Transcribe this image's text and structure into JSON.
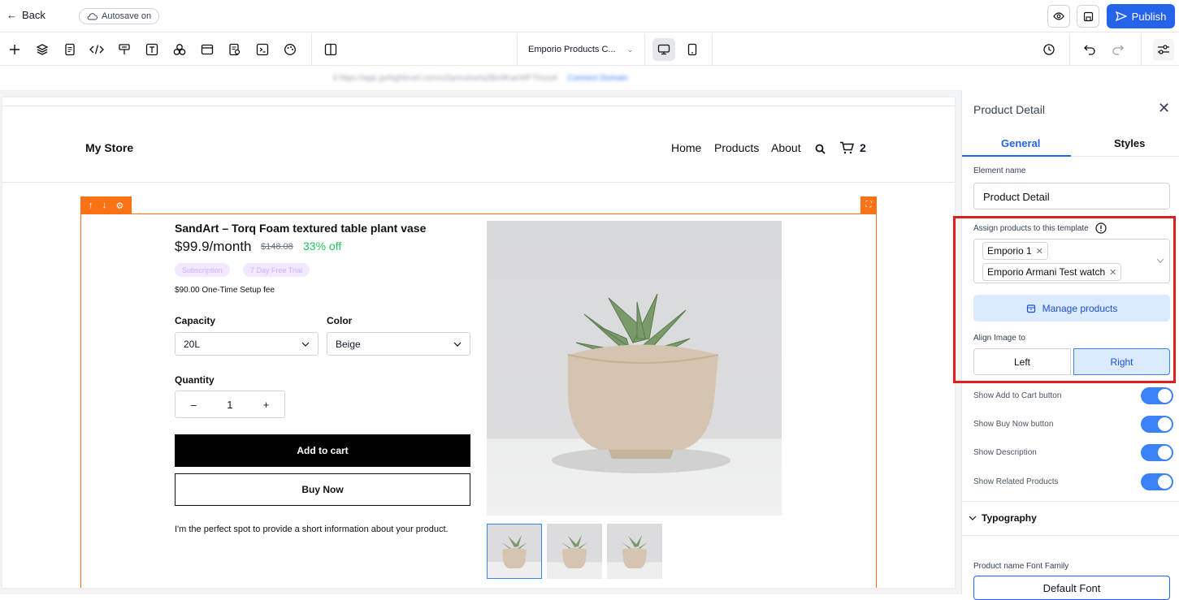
{
  "topbar": {
    "back_label": "Back",
    "autosave_label": "Autosave on",
    "publish_label": "Publish"
  },
  "toolbar": {
    "page_select_value": "Emporio Products C...",
    "tools": [
      "plus-icon",
      "layers-icon",
      "page-icon",
      "code-icon",
      "paint-icon",
      "text-icon",
      "shapes-icon",
      "section-icon",
      "form-icon",
      "terminal-icon",
      "palette-icon",
      "columns-icon"
    ]
  },
  "urlbar": {
    "url_text": "ℹ https://app.gohighlevel.com/v2/preview/aZBe9KaeWFThxzyk",
    "link_text": "Connect Domain"
  },
  "store": {
    "title": "My Store",
    "nav": [
      "Home",
      "Products",
      "About"
    ],
    "cart_count": "2"
  },
  "product": {
    "name": "SandArt – Torq Foam textured table plant vase",
    "price": "$99.9/month",
    "price_old": "$148.08",
    "discount": "33% off",
    "chips": [
      "Subscription",
      "7 Day Free Trial"
    ],
    "setup_fee": "$90.00 One-Time Setup fee",
    "capacity_label": "Capacity",
    "capacity_value": "20L",
    "color_label": "Color",
    "color_value": "Beige",
    "quantity_label": "Quantity",
    "quantity_value": "1",
    "add_to_cart": "Add to cart",
    "buy_now": "Buy Now",
    "description": "I'm the perfect spot to provide a short information about your product."
  },
  "panel": {
    "title": "Product Detail",
    "tabs": [
      "General",
      "Styles"
    ],
    "element_name_label": "Element name",
    "element_name_value": "Product Detail",
    "assign_label": "Assign products to this template",
    "assigned_products": [
      "Emporio 1",
      "Emporio Armani Test watch"
    ],
    "manage_products": "Manage products",
    "align_label": "Align Image to",
    "align_options": [
      "Left",
      "Right"
    ],
    "align_selected": "Right",
    "toggles": [
      {
        "label": "Show Add to Cart button",
        "on": true
      },
      {
        "label": "Show Buy Now button",
        "on": true
      },
      {
        "label": "Show Description",
        "on": true
      },
      {
        "label": "Show Related Products",
        "on": true
      }
    ],
    "typography_label": "Typography",
    "font_family_label": "Product name Font Family",
    "font_family_value": "Default Font"
  },
  "colors": {
    "accent": "#2563eb",
    "selection": "#f97316",
    "highlight": "#e11d1d",
    "discount": "#22c55e"
  }
}
